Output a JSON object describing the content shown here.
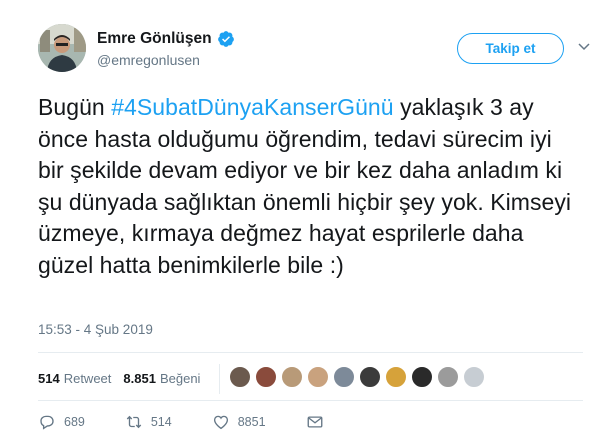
{
  "author": {
    "name": "Emre Gönlüşen",
    "handle": "@emregonlusen"
  },
  "follow_button": "Takip et",
  "tweet": {
    "text_before": "Bugün ",
    "hashtag": "#4SubatDünyaKanserGünü",
    "text_after": " yaklaşık 3 ay önce hasta olduğumu öğrendim, tedavi sürecim iyi bir şekilde devam ediyor ve bir kez daha anladım ki şu dünyada sağlıktan önemli hiçbir şey yok. Kimseyi üzmeye, kırmaya değmez hayat esprilerle daha güzel hatta benimkilerle bile :)"
  },
  "timestamp": "15:53 - 4 Şub 2019",
  "stats": {
    "retweet_count": "514",
    "retweet_label": "Retweet",
    "like_count": "8.851",
    "like_label": "Beğeni"
  },
  "likers": [
    {
      "color": "#6b5a4e"
    },
    {
      "color": "#8a4b3c"
    },
    {
      "color": "#b89a78"
    },
    {
      "color": "#c9a27e"
    },
    {
      "color": "#7d8a99"
    },
    {
      "color": "#3b3b3b"
    },
    {
      "color": "#d6a23a"
    },
    {
      "color": "#2a2a2a"
    },
    {
      "color": "#9b9b9b"
    },
    {
      "color": "#c7cdd3"
    }
  ],
  "actions": {
    "reply_count": "689",
    "retweet_count": "514",
    "like_count": "8851"
  },
  "colors": {
    "accent": "#1da1f2",
    "text": "#14171a",
    "secondary": "#657786"
  }
}
